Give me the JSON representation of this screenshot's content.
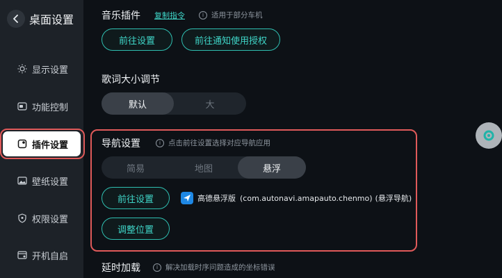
{
  "header": {
    "title": "桌面设置"
  },
  "sidebar": {
    "items": [
      {
        "label": "显示设置"
      },
      {
        "label": "功能控制"
      },
      {
        "label": "插件设置"
      },
      {
        "label": "壁纸设置"
      },
      {
        "label": "权限设置"
      },
      {
        "label": "开机自启"
      }
    ],
    "active_index": 2
  },
  "music_plugin": {
    "title": "音乐插件",
    "copy_link": "复制指令",
    "hint": "适用于部分车机",
    "goto_settings": "前往设置",
    "goto_notify_auth": "前往通知使用授权"
  },
  "lyrics": {
    "title": "歌词大小调节",
    "options": [
      "默认",
      "大"
    ],
    "selected": "默认"
  },
  "navigation": {
    "title": "导航设置",
    "hint": "点击前往设置选择对应导航应用",
    "modes": [
      "简易",
      "地图",
      "悬浮"
    ],
    "selected_mode": "悬浮",
    "goto_settings": "前往设置",
    "app_name": "高德悬浮版",
    "app_package": "(com.autonavi.amapauto.chenmo)",
    "app_tag": "(悬浮导航)",
    "adjust_position": "调整位置"
  },
  "delay_load": {
    "title": "延时加载",
    "hint": "解决加载时序问题造成的坐标错误"
  },
  "colors": {
    "accent": "#3fd6c8",
    "highlight": "#e05a5a",
    "background": "#0d1116",
    "sidebar": "#1d2228"
  },
  "icons": {
    "back": "chevron-left-icon",
    "display": "sun-icon",
    "function": "toggle-icon",
    "plugin": "plugin-icon",
    "wallpaper": "image-icon",
    "permission": "shield-icon",
    "autostart": "startup-icon",
    "floating": "floating-ball-icon"
  }
}
